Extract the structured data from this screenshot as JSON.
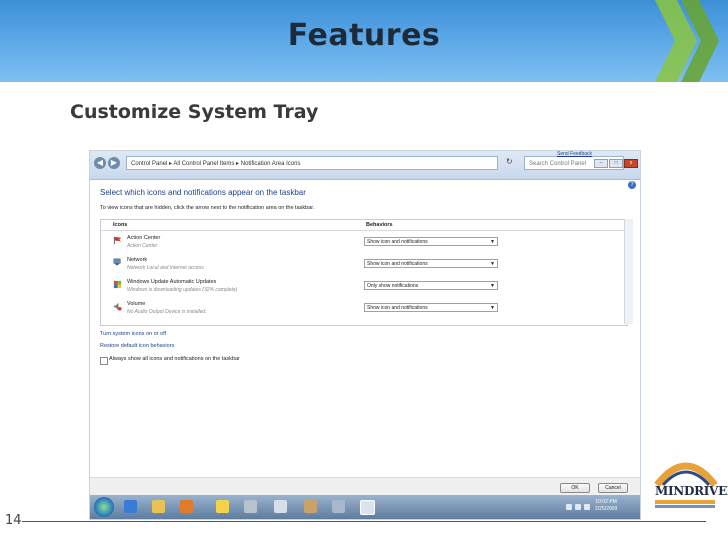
{
  "slide": {
    "title": "Features",
    "subtitle": "Customize System Tray",
    "page_number": "14",
    "colors": {
      "banner": "#4a9be0",
      "title": "#1c2a3a",
      "arrows": "#8bc53f"
    }
  },
  "window": {
    "breadcrumb": "Control Panel  ▸  All Control Panel Items  ▸  Notification Area Icons",
    "search_placeholder": "Search Control Panel",
    "send_feedback": "Send Feedback",
    "minimize": "–",
    "maximize": "□",
    "close": "x",
    "heading": "Select which icons and notifications appear on the taskbar",
    "intro": "To view icons that are hidden, click the arrow next to the notification area on the taskbar.",
    "columns": {
      "icons": "Icons",
      "behaviors": "Behaviors"
    },
    "rows": [
      {
        "name": "Action Center",
        "desc": "Action Center",
        "behavior": "Show icon and notifications",
        "icon": "flag-icon"
      },
      {
        "name": "Network",
        "desc": "Network Local and Internet access",
        "behavior": "Show icon and notifications",
        "icon": "network-icon"
      },
      {
        "name": "Windows Update Automatic Updates",
        "desc": "Windows is downloading updates (32% complete)",
        "behavior": "Only show notifications",
        "icon": "windows-update-icon"
      },
      {
        "name": "Volume",
        "desc": "No Audio Output Device is installed.",
        "behavior": "Show icon and notifications",
        "icon": "volume-icon"
      }
    ],
    "links": {
      "system_icons": "Turn system icons on or off",
      "restore": "Restore default icon behaviors"
    },
    "checkbox_label": "Always show all icons and notifications on the taskbar",
    "checkbox_checked": false,
    "ok": "OK",
    "cancel": "Cancel",
    "clock_time": "10:02 PM",
    "clock_date": "2/25/2009"
  },
  "logo": {
    "name": "MINDRIVER",
    "colors": {
      "arc": "#e7a23a",
      "arc2": "#2d4a8a"
    }
  }
}
